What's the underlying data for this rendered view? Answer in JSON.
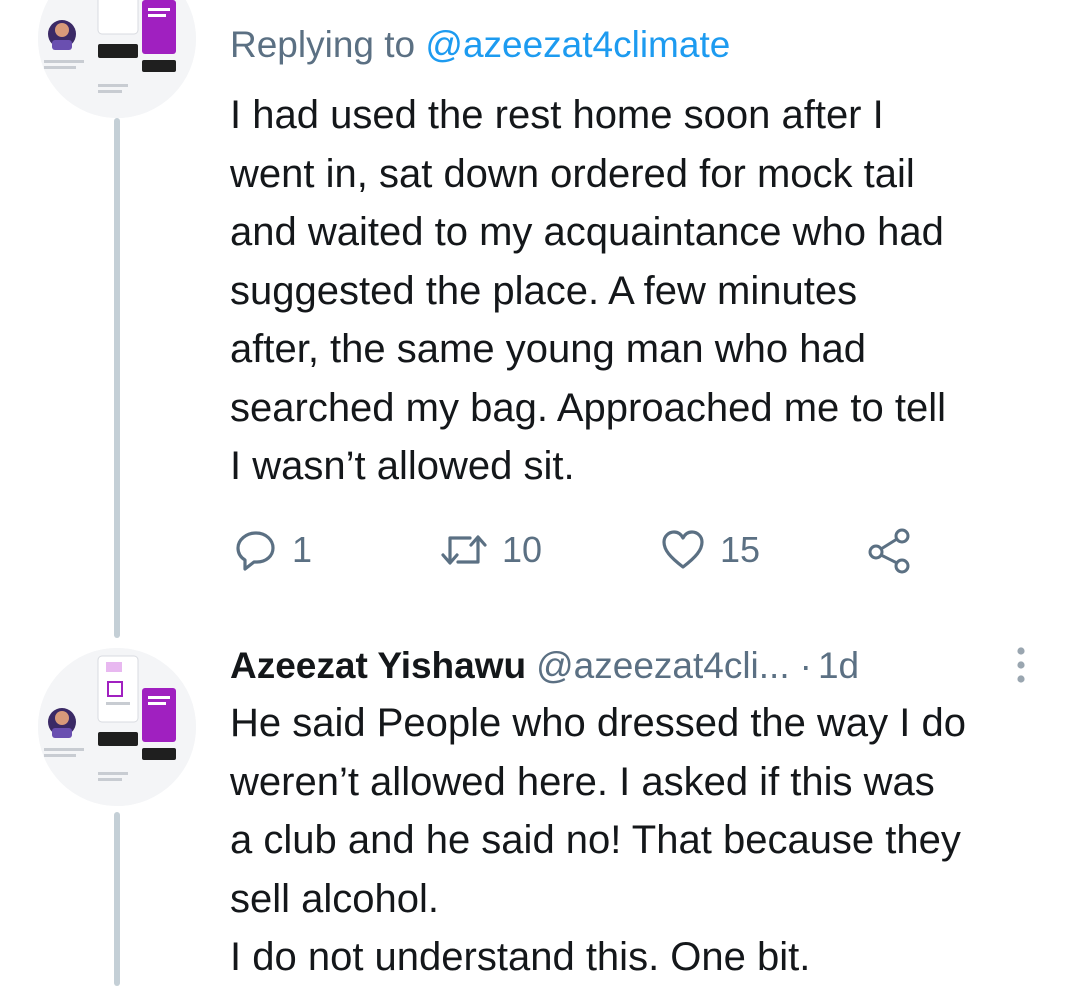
{
  "tweet1": {
    "replying_prefix": "Replying to",
    "replying_handle": "@azeezat4climate",
    "text": "I had used the rest home soon after I\nwent in, sat down ordered for mock tail\nand waited to my acquaintance who had\nsuggested the place. A few minutes\nafter, the same young man who had\nsearched my bag.  Approached me to tell\nI wasn’t allowed sit.",
    "actions": {
      "reply_count": "1",
      "retweet_count": "10",
      "like_count": "15"
    }
  },
  "tweet2": {
    "author_name": "Azeezat Yishawu",
    "author_handle": "@azeezat4cli...",
    "separator": "·",
    "timestamp": "1d",
    "text": "He said People who dressed the way I do\nweren’t allowed here. I asked if this was\na club and he said no! That because they\nsell alcohol.\nI do not understand this. One bit."
  },
  "colors": {
    "link": "#1d9bf0",
    "secondary_text": "#5b7083",
    "primary_text": "#14171a",
    "thread_line": "#c4cfd6",
    "avatar_accent": "#a020c0"
  },
  "icons": {
    "reply": "speech-bubble-icon",
    "retweet": "retweet-icon",
    "like": "heart-icon",
    "share": "share-nodes-icon",
    "more": "vertical-ellipsis-icon"
  }
}
